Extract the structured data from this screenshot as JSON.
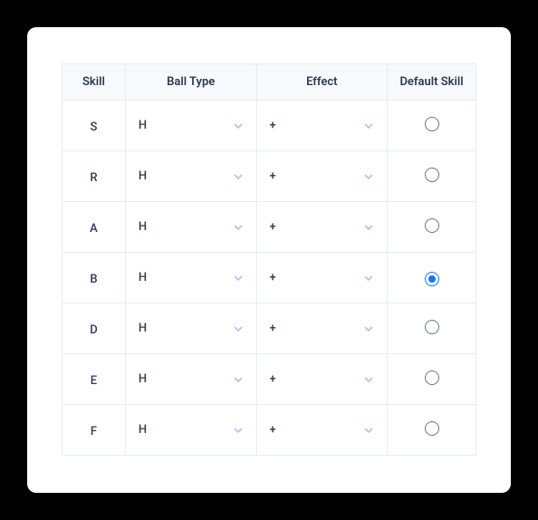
{
  "headers": {
    "skill": "Skill",
    "ballType": "Ball Type",
    "effect": "Effect",
    "defaultSkill": "Default Skill"
  },
  "rows": [
    {
      "skill": "S",
      "ballType": "H",
      "effect": "+",
      "default": false
    },
    {
      "skill": "R",
      "ballType": "H",
      "effect": "+",
      "default": false
    },
    {
      "skill": "A",
      "ballType": "H",
      "effect": "+",
      "default": false
    },
    {
      "skill": "B",
      "ballType": "H",
      "effect": "+",
      "default": true
    },
    {
      "skill": "D",
      "ballType": "H",
      "effect": "+",
      "default": false
    },
    {
      "skill": "E",
      "ballType": "H",
      "effect": "+",
      "default": false
    },
    {
      "skill": "F",
      "ballType": "H",
      "effect": "+",
      "default": false
    }
  ]
}
